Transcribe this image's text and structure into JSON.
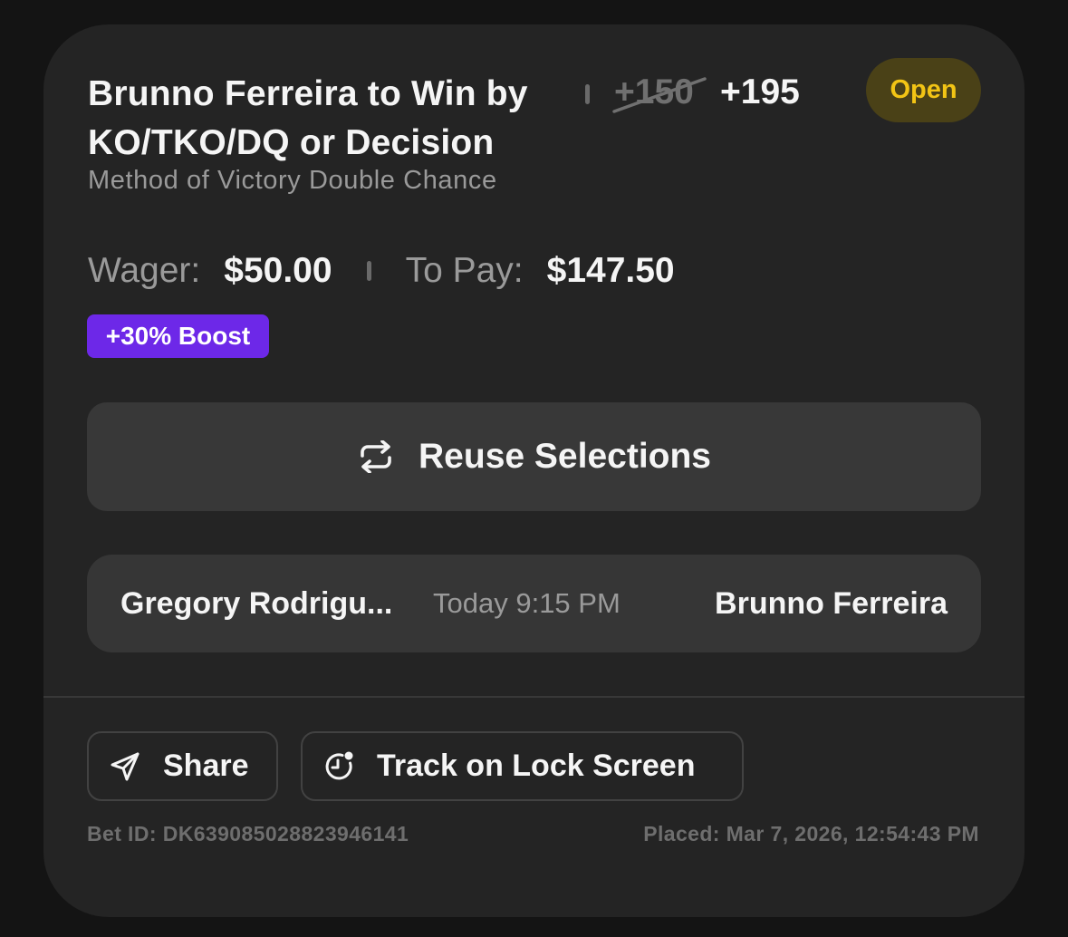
{
  "bet": {
    "title": "Brunno Ferreira to Win by KO/TKO/DQ or Decision",
    "market": "Method of Victory Double Chance",
    "old_odds": "+150",
    "new_odds": "+195",
    "status": "Open",
    "wager_label": "Wager:",
    "wager_value": "$50.00",
    "to_pay_label": "To Pay:",
    "to_pay_value": "$147.50",
    "boost_label": "+30% Boost"
  },
  "reuse": {
    "label": "Reuse Selections",
    "icon": "repeat-icon"
  },
  "matchup": {
    "fighter_left": "Gregory Rodrigu...",
    "time": "Today 9:15 PM",
    "fighter_right": "Brunno Ferreira"
  },
  "actions": {
    "share_label": "Share",
    "share_icon": "send-icon",
    "track_label": "Track on Lock Screen",
    "track_icon": "lock-screen-clock-icon"
  },
  "footer": {
    "bet_id": "Bet ID: DK639085028823946141",
    "placed": "Placed: Mar 7, 2026, 12:54:43 PM"
  },
  "colors": {
    "card_bg": "#242424",
    "status_text": "#f2c415",
    "status_bg": "#4a4117",
    "boost_bg": "#6d28e8",
    "button_bg": "#383838"
  }
}
